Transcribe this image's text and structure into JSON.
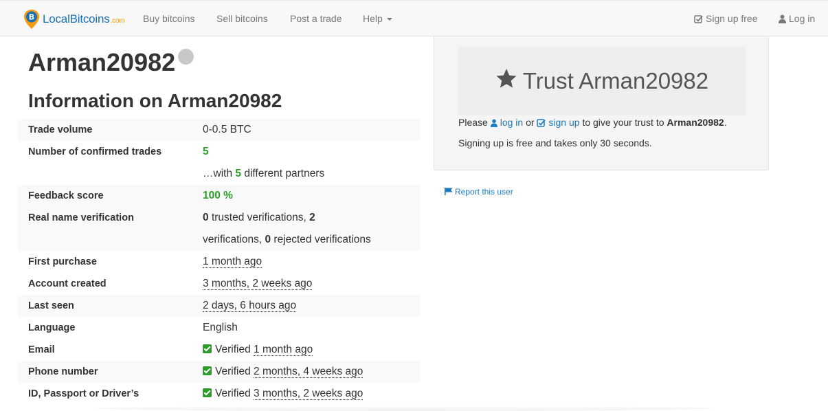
{
  "navbar": {
    "brand_name": "LocalBitcoins",
    "brand_suffix": ".com",
    "links": [
      {
        "label": "Buy bitcoins"
      },
      {
        "label": "Sell bitcoins"
      },
      {
        "label": "Post a trade"
      },
      {
        "label": "Help"
      }
    ],
    "signup_label": "Sign up free",
    "login_label": "Log in"
  },
  "profile": {
    "username": "Arman20982",
    "info_title": "Information on Arman20982"
  },
  "info": {
    "trade_volume": {
      "label": "Trade volume",
      "value": "0-0.5 BTC"
    },
    "confirmed_trades": {
      "label": "Number of confirmed trades",
      "value": "5",
      "partners_prefix": "…with",
      "partners_count": "5",
      "partners_suffix": "different partners"
    },
    "feedback": {
      "label": "Feedback score",
      "value": "100 %"
    },
    "real_name": {
      "label": "Real name verification",
      "trusted": "0",
      "trusted_text": "trusted verifications,",
      "verifications": "2",
      "verifications_text": "verifications,",
      "rejected": "0",
      "rejected_text": "rejected verifications"
    },
    "first_purchase": {
      "label": "First purchase",
      "value": "1 month ago"
    },
    "account_created": {
      "label": "Account created",
      "value": "3 months, 2 weeks ago"
    },
    "last_seen": {
      "label": "Last seen",
      "value": "2 days, 6 hours ago"
    },
    "language": {
      "label": "Language",
      "value": "English"
    },
    "email": {
      "label": "Email",
      "status": "Verified",
      "when": "1 month ago"
    },
    "phone": {
      "label": "Phone number",
      "status": "Verified",
      "when": "2 months, 4 weeks ago"
    },
    "id_doc": {
      "label": "ID, Passport or Driver’s",
      "status": "Verified",
      "when": "3 months, 2 weeks ago"
    }
  },
  "trust": {
    "heading": "Trust Arman20982",
    "please": "Please",
    "login_link": "log in",
    "or": "or",
    "signup_link": "sign up",
    "give_text": "to give your trust to",
    "username": "Arman20982",
    "period": ".",
    "free_note": "Signing up is free and takes only 30 seconds."
  },
  "report_label": "Report this user",
  "colors": {
    "accent_blue": "#1a7abf",
    "success_green": "#2a9d2a",
    "status_offline": "#c8c8c8"
  },
  "icons": {
    "brand": "bitcoin-pin-icon",
    "signup": "check-square-icon",
    "login": "user-icon",
    "trust": "star-icon",
    "report": "flag-icon",
    "verified": "check-square-icon"
  }
}
